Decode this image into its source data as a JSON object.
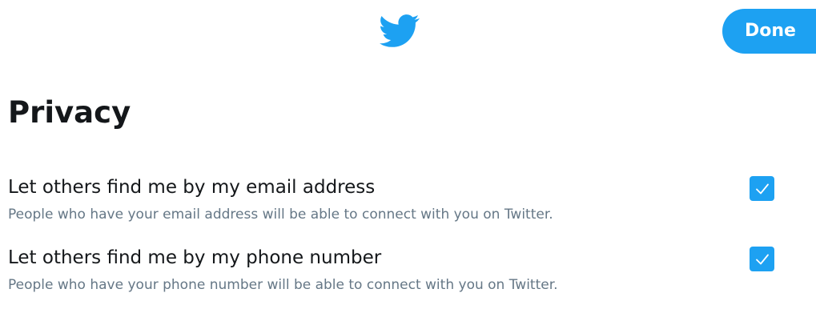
{
  "header": {
    "logo_icon": "twitter-bird-icon",
    "done_label": "Done",
    "accent_color": "#1da1f2"
  },
  "page": {
    "title": "Privacy"
  },
  "settings": [
    {
      "label": "Let others find me by my email address",
      "description": "People who have your email address will be able to connect with you on Twitter.",
      "checked": true
    },
    {
      "label": "Let others find me by my phone number",
      "description": "People who have your phone number will be able to connect with you on Twitter.",
      "checked": true
    }
  ]
}
